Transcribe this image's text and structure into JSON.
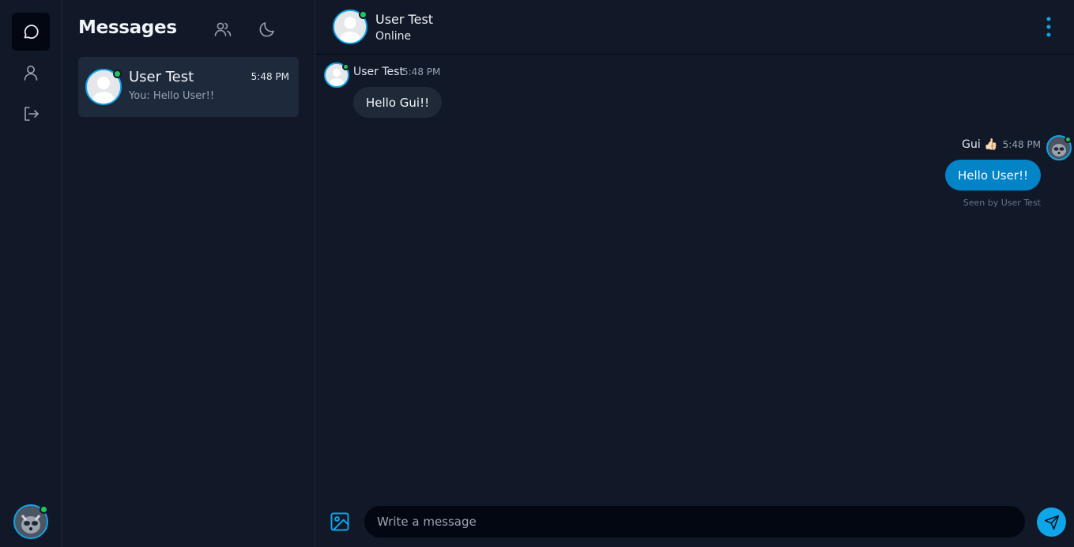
{
  "rail": {
    "items": [
      {
        "icon": "chat-bubble-icon",
        "active": true
      },
      {
        "icon": "user-icon",
        "active": false
      },
      {
        "icon": "logout-icon",
        "active": false
      }
    ],
    "avatar_icon": "user-avatar-photo"
  },
  "list": {
    "title": "Messages",
    "icons": [
      "users-icon",
      "moon-icon"
    ],
    "conversations": [
      {
        "name": "User Test",
        "time": "5:48 PM",
        "preview": "You: Hello User!!",
        "online": true
      }
    ]
  },
  "chat": {
    "header": {
      "name": "User Test",
      "status": "Online",
      "menu_icon": "more-vertical-icon"
    },
    "messages": [
      {
        "sender": "User Test",
        "time": "5:48 PM",
        "text": "Hello Gui!!",
        "direction": "incoming"
      },
      {
        "sender": "Gui 👍🏻",
        "time": "5:48 PM",
        "text": "Hello User!!",
        "direction": "outgoing",
        "seen": "Seen by User Test"
      }
    ],
    "composer": {
      "placeholder": "Write a message",
      "image_icon": "image-icon",
      "send_icon": "send-icon"
    }
  },
  "colors": {
    "background": "#111827",
    "accent": "#0ea5e9",
    "outgoing_bubble": "#0284c7",
    "incoming_bubble": "#1f2937",
    "online": "#22c55e"
  }
}
